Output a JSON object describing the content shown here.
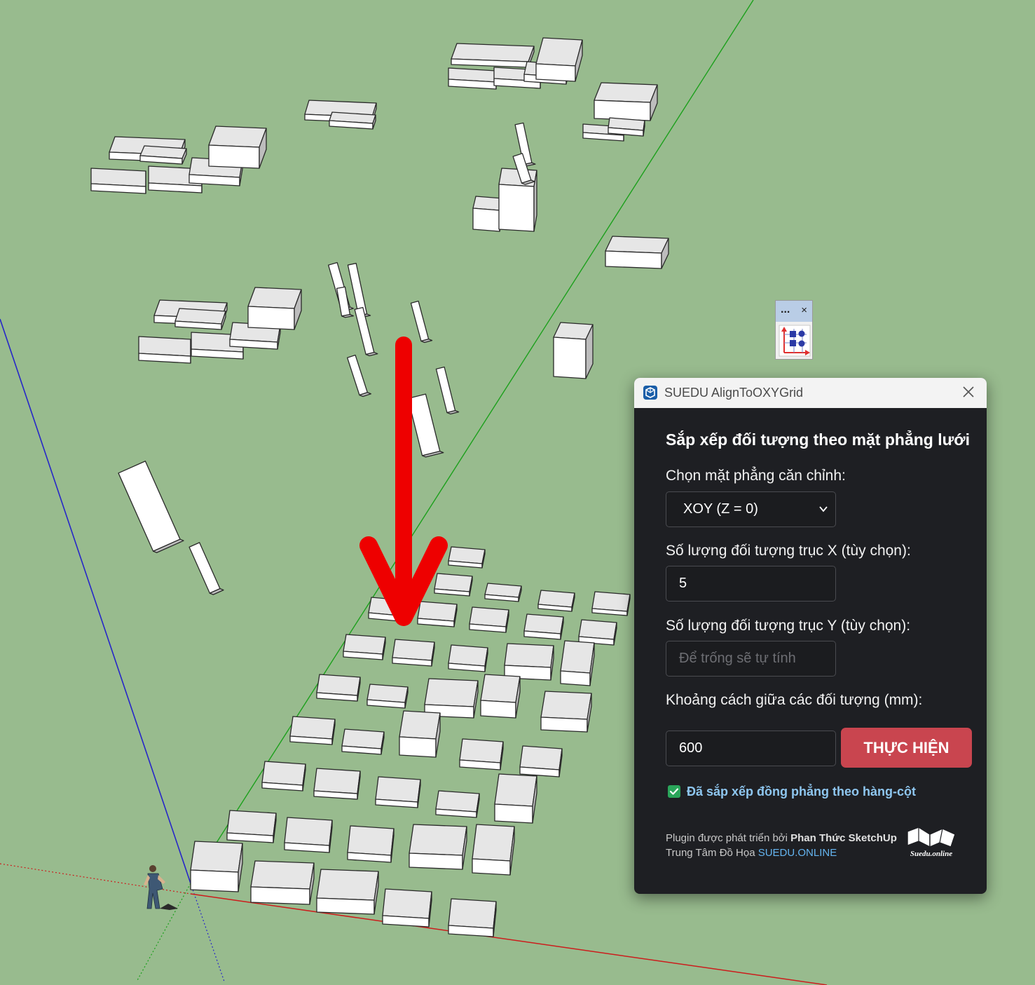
{
  "toolbar": {
    "title": "...",
    "close": "×",
    "button_icon": "align-grid-icon"
  },
  "dialog": {
    "title": "SUEDU AlignToOXYGrid",
    "heading": "Sắp xếp đối tượng theo mặt phẳng lưới",
    "plane_label": "Chọn mặt phẳng căn chỉnh:",
    "plane_value": "XOY (Z = 0)",
    "x_label": "Số lượng đối tượng trục X (tùy chọn):",
    "x_value": "5",
    "y_label": "Số lượng đối tượng trục Y (tùy chọn):",
    "y_placeholder": "Để trống sẽ tự tính",
    "spacing_label": "Khoảng cách giữa các đối tượng (mm):",
    "spacing_value": "600",
    "run_button": "THỰC HIỆN",
    "checkbox_label": "Đã sắp xếp đồng phẳng theo hàng-cột",
    "checkbox_checked": true,
    "credit_prefix": "Plugin được phát triển bởi ",
    "credit_author": "Phan Thức SketchUp",
    "credit_center_prefix": "Trung Tâm Đồ Họa ",
    "credit_site": "SUEDU.ONLINE",
    "logo_text": "Suedu.online"
  },
  "colors": {
    "ground": "#98bb8e",
    "dialog_bg": "#1e1f23",
    "run_button": "#c9454f",
    "checkbox": "#2aa55a",
    "link": "#64b4f0",
    "arrow": "#ee0000"
  }
}
